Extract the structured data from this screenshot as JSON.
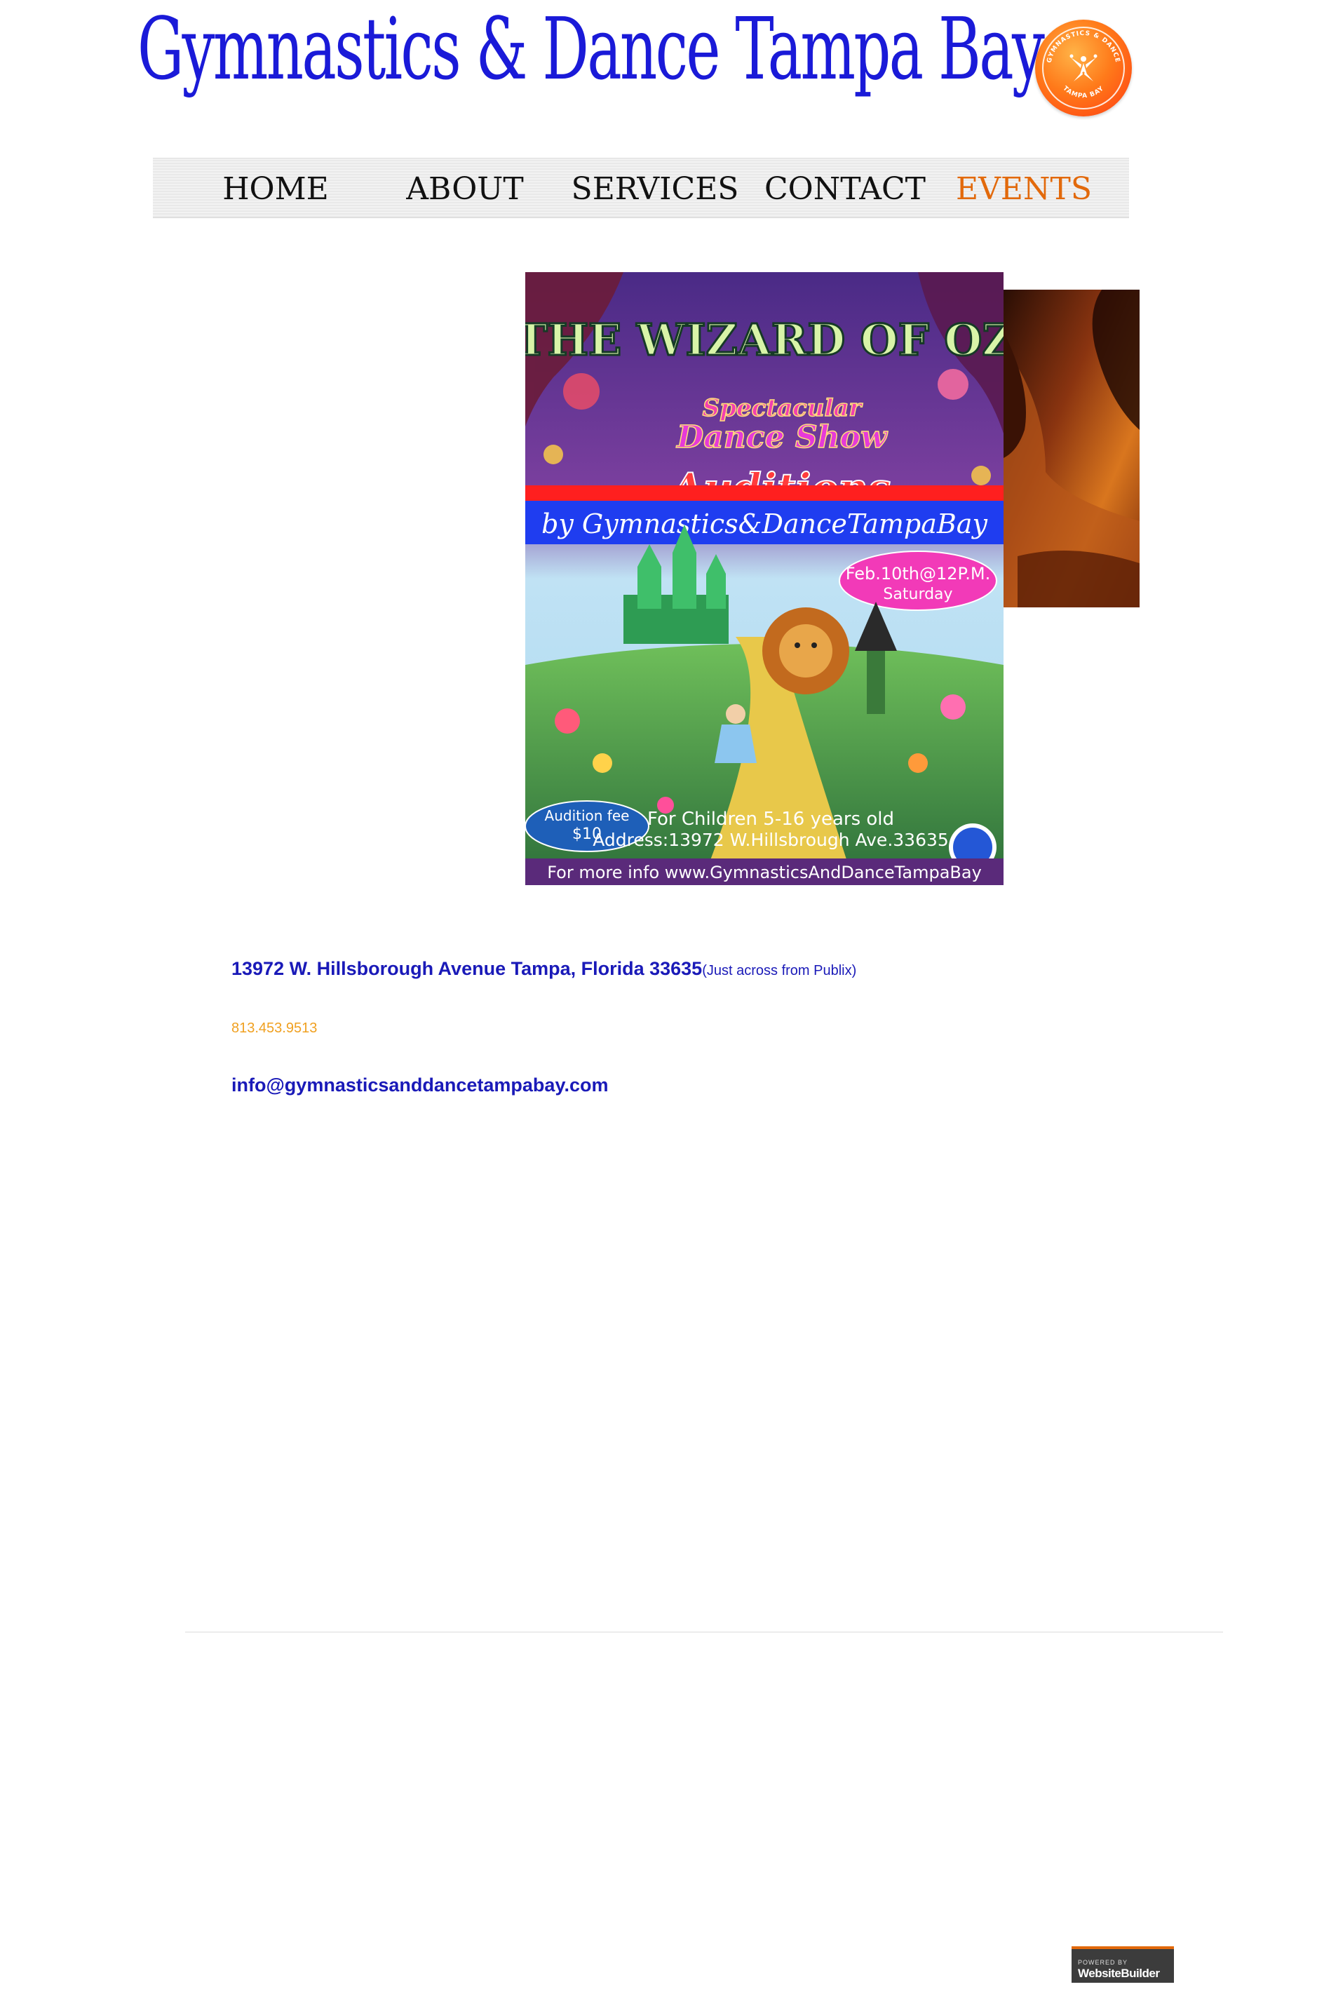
{
  "header": {
    "site_title": "Gymnastics & Dance Tampa Bay",
    "logo_text_top": "GYMNASTICS & DANCE",
    "logo_text_bottom": "TAMPA BAY"
  },
  "nav": {
    "items": [
      {
        "label": "HOME"
      },
      {
        "label": "ABOUT"
      },
      {
        "label": "SERVICES"
      },
      {
        "label": "CONTACT"
      },
      {
        "label": "EVENTS",
        "active": true
      }
    ],
    "active_color": "#e2690b"
  },
  "poster": {
    "title": "THE WIZARD OF OZ",
    "subtitle_1": "Spectacular",
    "subtitle_2": "Dance Show",
    "auditions": "Auditions",
    "by_line": "by Gymnastics&DanceTampaBay",
    "date_1": "Feb.10th@12P.M.",
    "date_2": "Saturday",
    "fee_1": "Audition fee",
    "fee_2": "$10",
    "ages": "For Children 5-16 years old",
    "address": "Address:13972 W.Hillsbrough Ave.33635",
    "info": "For more info www.GymnasticsAndDanceTampaBay"
  },
  "contact": {
    "address": "13972 W. Hillsborough Avenue Tampa, Florida   33635",
    "address_note": "(Just across from Publix)",
    "phone": "813.453.9513",
    "email": "info@gymnasticsanddancetampabay.com"
  },
  "footer": {
    "badge_small": "POWERED BY",
    "badge_big": "WebsiteBuilder"
  },
  "colors": {
    "title_blue": "#1a1ad8",
    "link_blue": "#1a1ab8",
    "phone_orange": "#f0a020"
  }
}
